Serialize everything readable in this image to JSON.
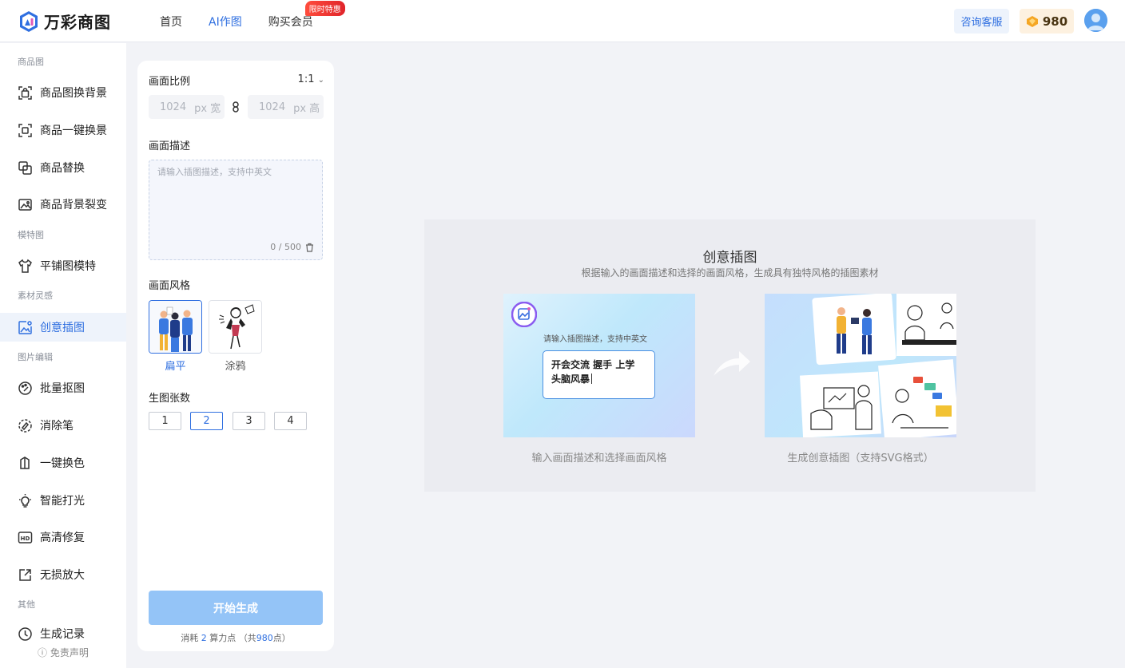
{
  "header": {
    "logo_text": "万彩商图",
    "nav": [
      {
        "label": "首页"
      },
      {
        "label": "AI作图"
      },
      {
        "label": "购买会员",
        "badge": "限时特惠"
      }
    ],
    "consult_label": "咨询客服",
    "points": "980"
  },
  "sidebar": {
    "sections": [
      "商品图",
      "模特图",
      "素材灵感",
      "图片编辑",
      "其他"
    ],
    "items": [
      {
        "label": "商品图换背景",
        "icon": "bag-frame-icon"
      },
      {
        "label": "商品一键换景",
        "icon": "scan-frame-icon"
      },
      {
        "label": "商品替换",
        "icon": "swap-frame-icon"
      },
      {
        "label": "商品背景裂变",
        "icon": "image-split-icon"
      },
      {
        "label": "平铺图模特",
        "icon": "shirt-icon"
      },
      {
        "label": "创意插图",
        "icon": "creative-image-icon"
      },
      {
        "label": "批量抠图",
        "icon": "palette-icon"
      },
      {
        "label": "消除笔",
        "icon": "eraser-circle-icon"
      },
      {
        "label": "一键换色",
        "icon": "color-swap-icon"
      },
      {
        "label": "智能打光",
        "icon": "bulb-icon"
      },
      {
        "label": "高清修复",
        "icon": "hd-icon"
      },
      {
        "label": "无损放大",
        "icon": "expand-icon"
      },
      {
        "label": "生成记录",
        "icon": "clock-icon"
      }
    ],
    "disclaimer": "ⓘ 免责声明"
  },
  "panel": {
    "ratio_label": "画面比例",
    "ratio_value": "1:1",
    "width_value": "1024",
    "width_unit": "px 宽",
    "height_value": "1024",
    "height_unit": "px 高",
    "desc_label": "画面描述",
    "desc_placeholder": "请输入插图描述，支持中英文",
    "desc_count": "0 / 500",
    "style_label": "画面风格",
    "styles": [
      {
        "name": "扁平",
        "selected": true
      },
      {
        "name": "涂鸦",
        "selected": false
      }
    ],
    "count_label": "生图张数",
    "counts": [
      "1",
      "2",
      "3",
      "4"
    ],
    "selected_count": "2",
    "generate_label": "开始生成",
    "cost_prefix": "消耗",
    "cost_value": "2",
    "cost_unit": "算力点",
    "cost_total_prefix": "（共",
    "cost_total": "980",
    "cost_total_suffix": "点）"
  },
  "intro": {
    "title": "创意插图",
    "subtitle": "根据输入的画面描述和选择的画面风格，生成具有独特风格的插图素材",
    "demo_hint": "请输入插图描述，支持中英文",
    "demo_line1": "开会交流  握手  上学",
    "demo_line2": "头脑风暴",
    "caption_left": "输入画面描述和选择画面风格",
    "caption_right": "生成创意插图（支持SVG格式）"
  },
  "colors": {
    "accent": "#2f6fe0",
    "generate_button": "#94c4f7",
    "promo_badge": "#e0242a",
    "page_bg": "#f2f3f7"
  }
}
